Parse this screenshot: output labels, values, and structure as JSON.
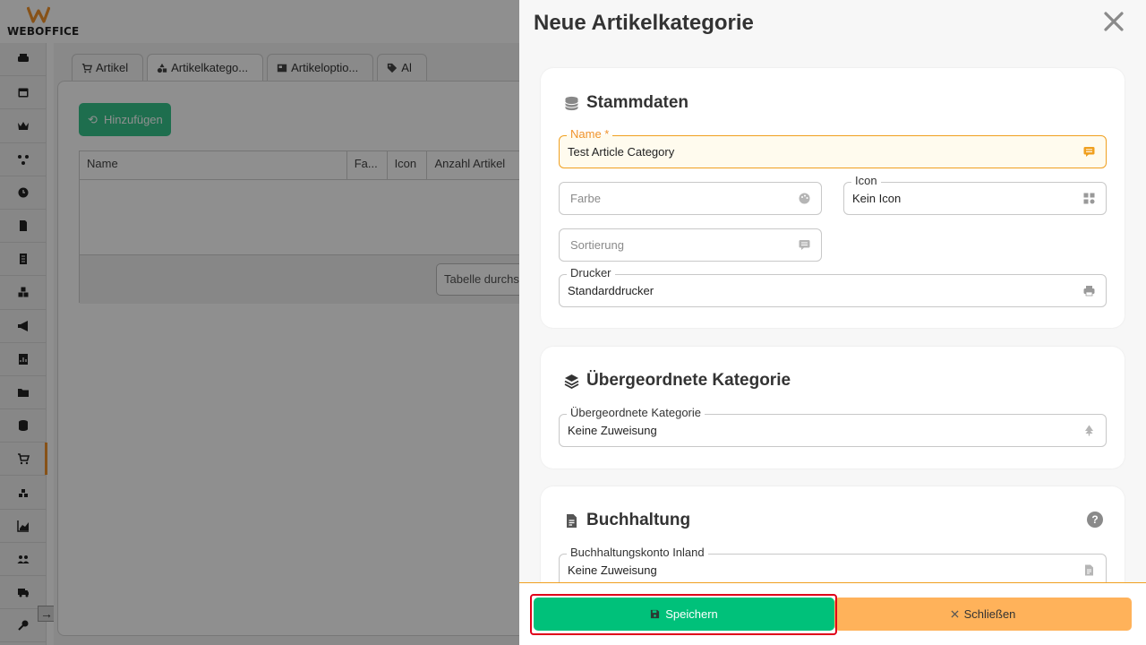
{
  "app": {
    "logo_text": "WEBOFFICE",
    "accent_color": "#f0932b",
    "sidebar_icons": [
      "printer-icon",
      "calendar-icon",
      "crown-icon",
      "network-icon",
      "clock-icon",
      "document-icon",
      "list-icon",
      "cubes-icon",
      "megaphone-icon",
      "report-icon",
      "folder-icon",
      "database-icon",
      "cart-icon",
      "warehouse-icon",
      "chart-icon",
      "users-icon",
      "truck-icon",
      "key-icon"
    ],
    "active_sidebar_index": 12
  },
  "tabs": [
    {
      "label": "Artikel",
      "icon": "cart-icon"
    },
    {
      "label": "Artikelkatego...",
      "icon": "shapes-icon"
    },
    {
      "label": "Artikeloptio...",
      "icon": "options-icon"
    },
    {
      "label": "Al",
      "icon": "tag-icon"
    }
  ],
  "toolbar": {
    "add_label": "Hinzufügen"
  },
  "table": {
    "columns": [
      "Name",
      "Fa...",
      "Icon",
      "Anzahl Artikel"
    ],
    "search_placeholder": "Tabelle durchs"
  },
  "drawer": {
    "title": "Neue Artikelkategorie",
    "sections": {
      "master": {
        "title": "Stammdaten",
        "name_label": "Name *",
        "name_value": "Test Article Category",
        "color_placeholder": "Farbe",
        "icon_label": "Icon",
        "icon_value": "Kein Icon",
        "sort_placeholder": "Sortierung",
        "printer_label": "Drucker",
        "printer_value": "Standarddrucker"
      },
      "parent": {
        "title": "Übergeordnete Kategorie",
        "field_label": "Übergeordnete Kategorie",
        "field_value": "Keine Zuweisung"
      },
      "accounting": {
        "title": "Buchhaltung",
        "help": "?",
        "domestic_label": "Buchhaltungskonto Inland",
        "domestic_value": "Keine Zuweisung"
      }
    },
    "footer": {
      "save_label": "Speichern",
      "close_label": "Schließen",
      "save_color": "#00c17a",
      "close_color": "#ffb25a",
      "highlight_color": "#e0001a"
    }
  }
}
